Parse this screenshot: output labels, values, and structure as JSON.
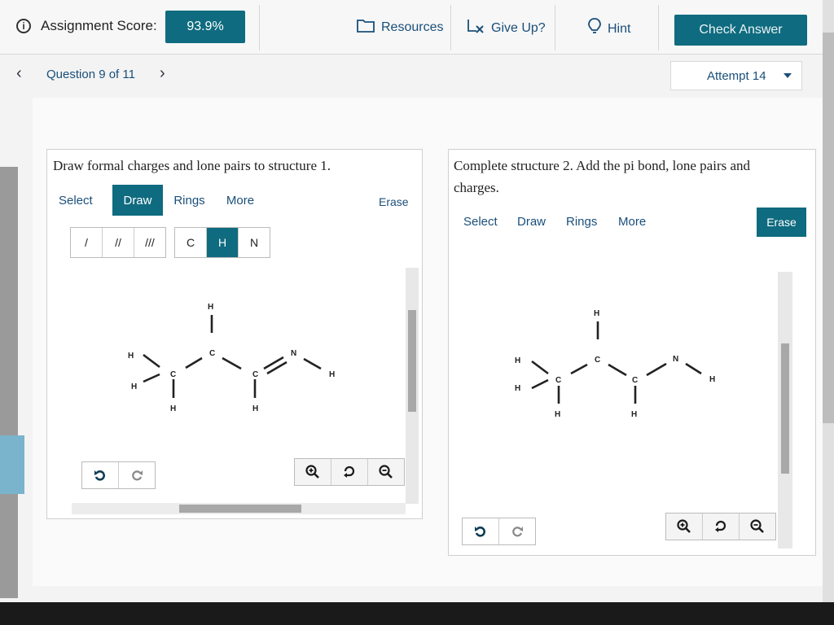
{
  "topbar": {
    "score_label": "Assignment Score:",
    "score_value": "93.9%",
    "resources": "Resources",
    "give_up": "Give Up?",
    "hint": "Hint",
    "check_answer": "Check Answer"
  },
  "question": {
    "label": "Question 9 of 11",
    "attempt": "Attempt 14"
  },
  "panel1": {
    "prompt": "Draw formal charges and lone pairs to structure 1.",
    "tools": [
      "Select",
      "Draw",
      "Rings",
      "More"
    ],
    "active_tool": "Draw",
    "erase": "Erase",
    "bonds": [
      "/",
      "//",
      "///"
    ],
    "atoms": [
      "C",
      "H",
      "N"
    ],
    "active_atom": "H"
  },
  "panel2": {
    "prompt": "Complete structure 2. Add the pi bond, lone pairs and charges.",
    "tools": [
      "Select",
      "Draw",
      "Rings",
      "More"
    ],
    "erase": "Erase"
  },
  "molecule_atoms": {
    "h": "H",
    "c": "C",
    "n": "N"
  },
  "colors": {
    "accent": "#0f6b7f",
    "link": "#1a4f7a"
  }
}
